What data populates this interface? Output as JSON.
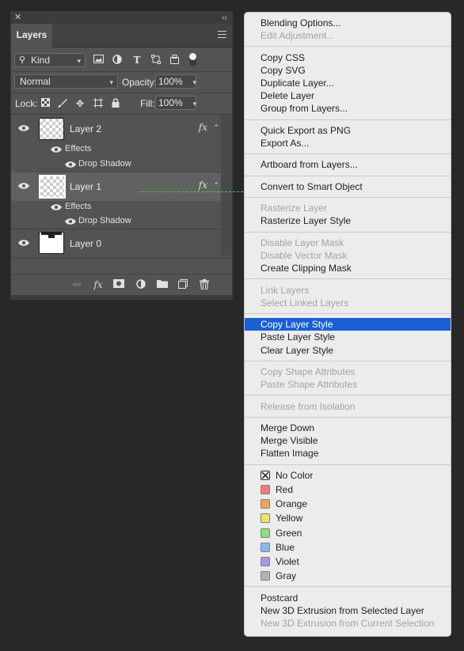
{
  "panel": {
    "tab_label": "Layers",
    "filter_kind": "Kind",
    "blend_mode": "Normal",
    "opacity_label": "Opacity:",
    "opacity_value": "100%",
    "lock_label": "Lock:",
    "fill_label": "Fill:",
    "fill_value": "100%",
    "layers": [
      {
        "name": "Layer 2",
        "fx": "fx",
        "effects_label": "Effects",
        "effect": "Drop Shadow"
      },
      {
        "name": "Layer 1",
        "fx": "fx",
        "effects_label": "Effects",
        "effect": "Drop Shadow"
      },
      {
        "name": "Layer 0"
      }
    ],
    "bottom_fx": "fx"
  },
  "drag_line_color": "#3fd33f",
  "menu": {
    "highlight_color": "#1b5fd6",
    "groups": [
      [
        {
          "label": "Blending Options...",
          "disabled": false
        },
        {
          "label": "Edit Adjustment...",
          "disabled": true
        }
      ],
      [
        {
          "label": "Copy CSS",
          "disabled": false
        },
        {
          "label": "Copy SVG",
          "disabled": false
        },
        {
          "label": "Duplicate Layer...",
          "disabled": false
        },
        {
          "label": "Delete Layer",
          "disabled": false
        },
        {
          "label": "Group from Layers...",
          "disabled": false
        }
      ],
      [
        {
          "label": "Quick Export as PNG",
          "disabled": false
        },
        {
          "label": "Export As...",
          "disabled": false
        }
      ],
      [
        {
          "label": "Artboard from Layers...",
          "disabled": false
        }
      ],
      [
        {
          "label": "Convert to Smart Object",
          "disabled": false
        }
      ],
      [
        {
          "label": "Rasterize Layer",
          "disabled": true
        },
        {
          "label": "Rasterize Layer Style",
          "disabled": false
        }
      ],
      [
        {
          "label": "Disable Layer Mask",
          "disabled": true
        },
        {
          "label": "Disable Vector Mask",
          "disabled": true
        },
        {
          "label": "Create Clipping Mask",
          "disabled": false
        }
      ],
      [
        {
          "label": "Link Layers",
          "disabled": true
        },
        {
          "label": "Select Linked Layers",
          "disabled": true
        }
      ],
      [
        {
          "label": "Copy Layer Style",
          "disabled": false,
          "highlighted": true
        },
        {
          "label": "Paste Layer Style",
          "disabled": false
        },
        {
          "label": "Clear Layer Style",
          "disabled": false
        }
      ],
      [
        {
          "label": "Copy Shape Attributes",
          "disabled": true
        },
        {
          "label": "Paste Shape Attributes",
          "disabled": true
        }
      ],
      [
        {
          "label": "Release from Isolation",
          "disabled": true
        }
      ],
      [
        {
          "label": "Merge Down",
          "disabled": false
        },
        {
          "label": "Merge Visible",
          "disabled": false
        },
        {
          "label": "Flatten Image",
          "disabled": false
        }
      ]
    ],
    "colors": [
      {
        "label": "No Color",
        "color": "none"
      },
      {
        "label": "Red",
        "color": "#f07a7a"
      },
      {
        "label": "Orange",
        "color": "#f4a35a"
      },
      {
        "label": "Yellow",
        "color": "#efe36a"
      },
      {
        "label": "Green",
        "color": "#8fdc7c"
      },
      {
        "label": "Blue",
        "color": "#8ab7ef"
      },
      {
        "label": "Violet",
        "color": "#ab94e6"
      },
      {
        "label": "Gray",
        "color": "#b2b2b2"
      }
    ],
    "tail": [
      {
        "label": "Postcard",
        "disabled": false
      },
      {
        "label": "New 3D Extrusion from Selected Layer",
        "disabled": false
      },
      {
        "label": "New 3D Extrusion from Current Selection",
        "disabled": true
      }
    ]
  }
}
